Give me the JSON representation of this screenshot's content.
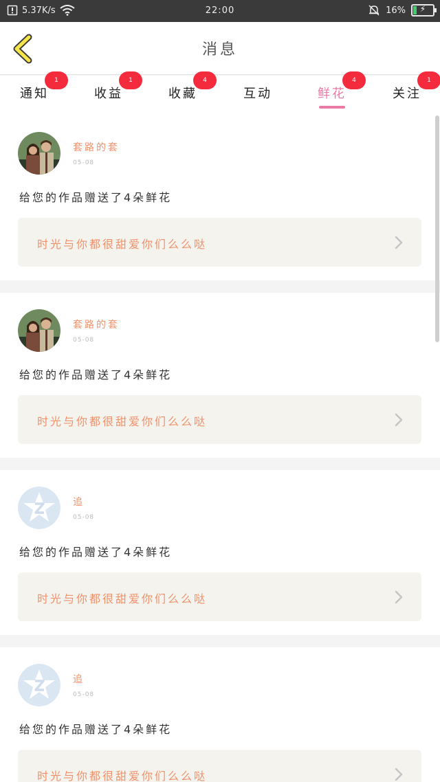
{
  "status_bar": {
    "network_speed": "5.37K/s",
    "time": "22:00",
    "battery_percent": "16%",
    "battery_level": 0.16,
    "icons": [
      "notification-icon",
      "wifi-icon",
      "mute-icon",
      "battery-icon"
    ]
  },
  "header": {
    "title": "消息",
    "back_icon": "back-chevron-icon"
  },
  "tabs": [
    {
      "label": "通知",
      "badge": "1"
    },
    {
      "label": "收益",
      "badge": "1"
    },
    {
      "label": "收藏",
      "badge": "4"
    },
    {
      "label": "互动",
      "badge": ""
    },
    {
      "label": "鲜花",
      "badge": "4",
      "active": true
    },
    {
      "label": "关注",
      "badge": "1"
    }
  ],
  "feed": [
    {
      "username": "套路的套",
      "date": "05-08",
      "message": "给您的作品赠送了4朵鲜花",
      "work_title": "时光与你都很甜爱你们么么哒",
      "avatar": "photo"
    },
    {
      "username": "套路的套",
      "date": "05-08",
      "message": "给您的作品赠送了4朵鲜花",
      "work_title": "时光与你都很甜爱你们么么哒",
      "avatar": "photo"
    },
    {
      "username": "追",
      "date": "05-08",
      "message": "给您的作品赠送了4朵鲜花",
      "work_title": "时光与你都很甜爱你们么么哒",
      "avatar": "qq-default"
    },
    {
      "username": "追",
      "date": "05-08",
      "message": "给您的作品赠送了4朵鲜花",
      "work_title": "时光与你都很甜爱你们么么哒",
      "avatar": "qq-default"
    }
  ],
  "colors": {
    "accent_pink": "#e87aa4",
    "badge_red": "#f42a3d",
    "link_orange": "#f0916a",
    "back_yellow": "#f7e64a"
  }
}
